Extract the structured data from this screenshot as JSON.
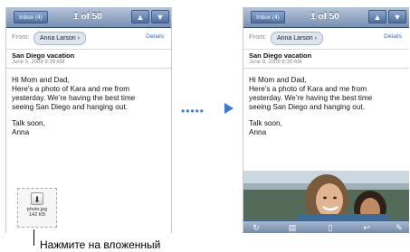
{
  "left_screen": {
    "nav": {
      "inbox_label": "Inbox (4)",
      "counter": "1 of 50",
      "up_glyph": "▲",
      "down_glyph": "▼"
    },
    "from_label": "From:",
    "sender": "Anna Larson",
    "sender_chevron": "›",
    "details_label": "Details",
    "subject": "San Diego vacation",
    "date": "June 9, 2009 9:39 AM",
    "body_lines": [
      "Hi Mom and Dad,",
      "Here’s a photo of Kara and me from",
      "yesterday. We’re having the best time",
      "seeing San Diego and hanging out.",
      "",
      "Talk soon,",
      "Anna"
    ],
    "attachment": {
      "icon": "download-icon",
      "glyph": "⬇",
      "filename": "photo.jpg",
      "size": "142 KB"
    }
  },
  "right_screen": {
    "nav": {
      "inbox_label": "Inbox (4)",
      "counter": "1 of 50",
      "up_glyph": "▲",
      "down_glyph": "▼"
    },
    "from_label": "From:",
    "sender": "Anna Larson",
    "sender_chevron": "›",
    "details_label": "Details",
    "subject": "San Diego vacation",
    "date": "June 9, 2009 9:39 AM",
    "body_lines": [
      "Hi Mom and Dad,",
      "Here’s a photo of Kara and me from",
      "yesterday. We’re having the best time",
      "seeing San Diego and hanging out.",
      "",
      "Talk soon,",
      "Anna"
    ],
    "toolbar": {
      "refresh": "↻",
      "move": "▤",
      "trash": "▯",
      "reply": "↩",
      "compose": "✎"
    }
  },
  "transition_arrow": "•••••",
  "caption": "Нажмите на вложенный",
  "colors": {
    "nav_blue": "#7690b4",
    "link_blue": "#3a68b0",
    "arrow_blue": "#3a7ad0"
  }
}
